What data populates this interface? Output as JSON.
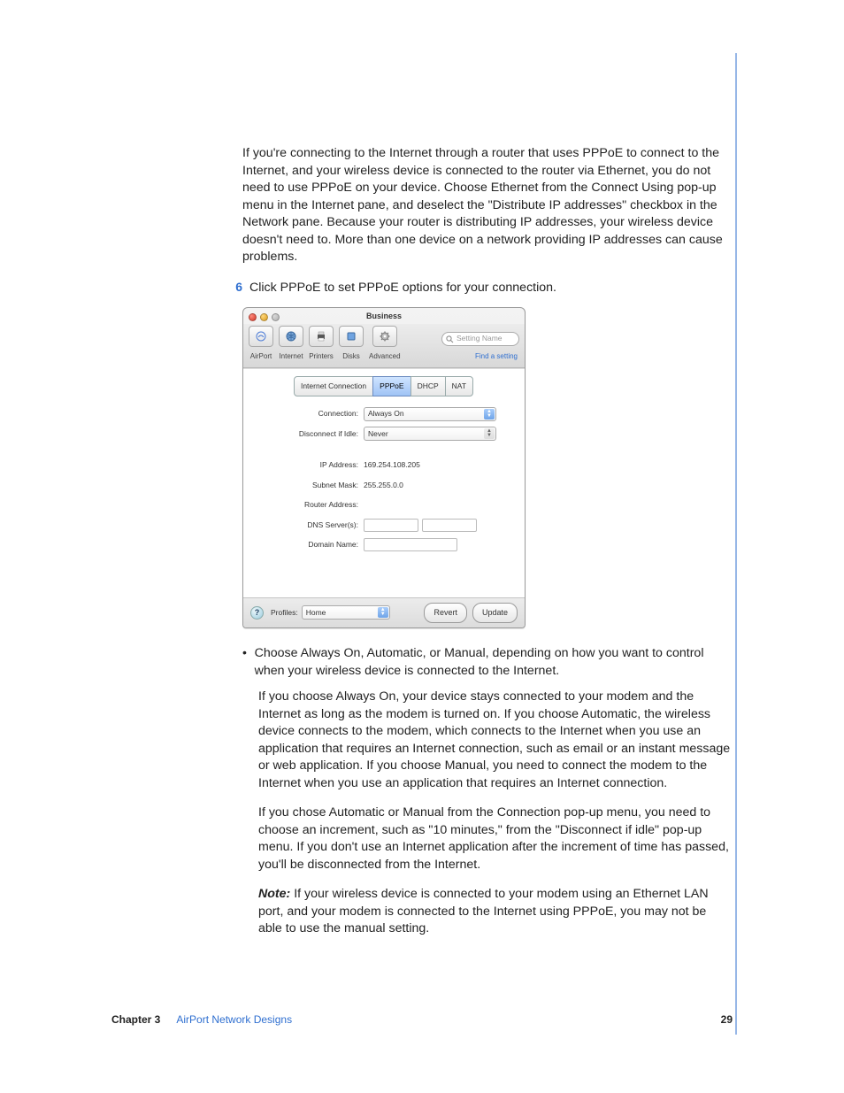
{
  "paragraphs": {
    "intro": "If you're connecting to the Internet through a router that uses PPPoE to connect to the Internet, and your wireless device is connected to the router via Ethernet, you do not need to use PPPoE on your device. Choose Ethernet from the Connect Using pop-up menu in the Internet pane, and deselect the \"Distribute IP addresses\" checkbox in the Network pane. Because your router is distributing IP addresses, your wireless device doesn't need to. More than one device on a network providing IP addresses can cause problems.",
    "step_label": "6",
    "step_text": "Click PPPoE to set PPPoE options for your connection.",
    "bullet_text": "Choose Always On, Automatic, or Manual, depending on how you want to control when your wireless device is connected to the Internet.",
    "p2": "If you choose Always On, your device stays connected to your modem and the Internet as long as the modem is turned on. If you choose Automatic, the wireless device connects to the modem, which connects to the Internet when you use an application that requires an Internet connection, such as email or an instant message or web application. If you choose Manual, you need to connect the modem to the Internet when you use an application that requires an Internet connection.",
    "p3": "If you chose Automatic or Manual from the Connection pop-up menu, you need to choose an increment, such as \"10 minutes,\" from the \"Disconnect if idle\" pop-up menu. If you don't use an Internet application after the increment of time has passed, you'll be disconnected from the Internet.",
    "note_label": "Note:",
    "note_text": "  If your wireless device is connected to your modem using an Ethernet LAN port, and your modem is connected to the Internet using PPPoE, you may not be able to use the manual setting."
  },
  "window": {
    "title": "Business",
    "toolbar": {
      "items": [
        "AirPort",
        "Internet",
        "Printers",
        "Disks",
        "Advanced"
      ],
      "search_placeholder": "Setting Name",
      "search_hint": "Find a setting"
    },
    "tabs": [
      "Internet Connection",
      "PPPoE",
      "DHCP",
      "NAT"
    ],
    "active_tab": "PPPoE",
    "fields": {
      "connection_label": "Connection:",
      "connection_value": "Always On",
      "disconnect_label": "Disconnect if Idle:",
      "disconnect_value": "Never",
      "ip_label": "IP Address:",
      "ip_value": "169.254.108.205",
      "subnet_label": "Subnet Mask:",
      "subnet_value": "255.255.0.0",
      "router_label": "Router Address:",
      "dns_label": "DNS Server(s):",
      "domain_label": "Domain Name:"
    },
    "bottom": {
      "profiles_label": "Profiles:",
      "profiles_value": "Home",
      "revert": "Revert",
      "update": "Update"
    }
  },
  "footer": {
    "chapter": "Chapter 3",
    "title": "AirPort Network Designs",
    "page": "29"
  }
}
